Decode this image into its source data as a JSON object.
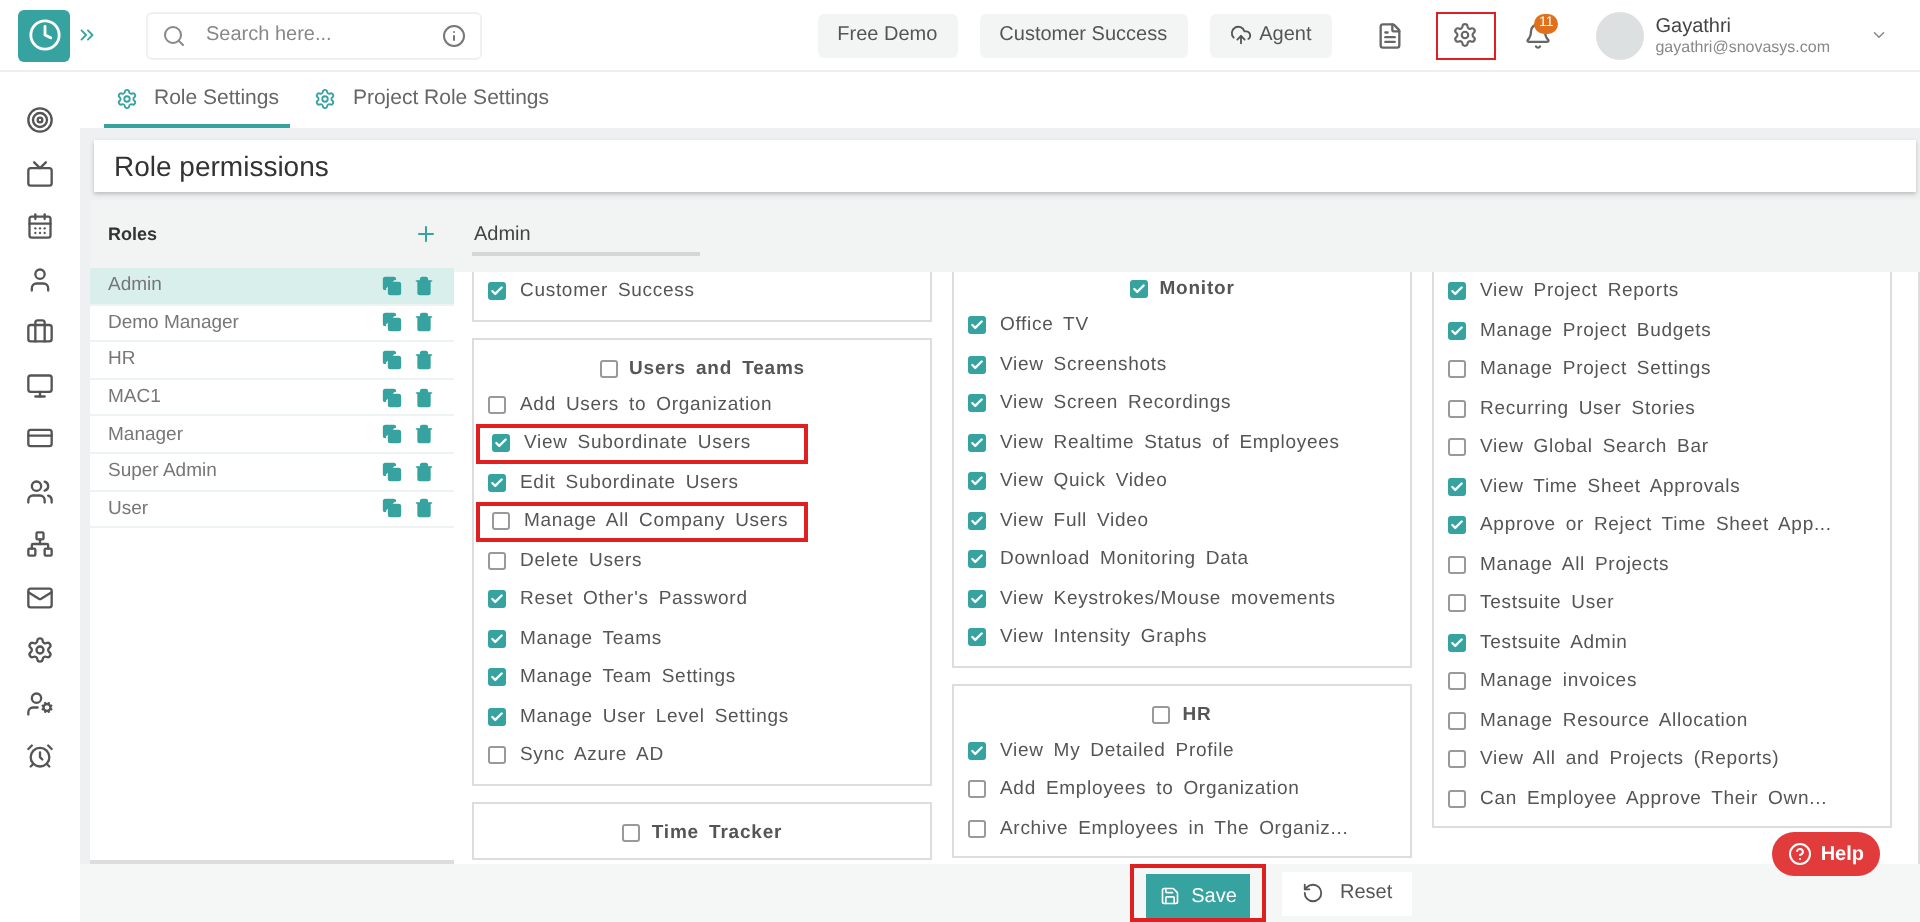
{
  "top_bar": {
    "search": {
      "placeholder": "Search here..."
    },
    "buttons": [
      {
        "label": "Free Demo",
        "kind": "plain"
      },
      {
        "label": "Customer Success",
        "kind": "plain"
      },
      {
        "label": "Agent",
        "kind": "cloud"
      }
    ],
    "settings_highlighted": true,
    "notification_count": "11",
    "user": {
      "name": "Gayathri",
      "email": "gayathri@snovasys.com"
    }
  },
  "tabs": [
    {
      "label": "Role Settings",
      "selected": true
    },
    {
      "label": "Project Role Settings",
      "selected": false
    }
  ],
  "page_title": "Role permissions",
  "roles": {
    "title": "Roles",
    "items": [
      {
        "name": "Admin",
        "selected": true
      },
      {
        "name": "Demo Manager",
        "selected": false
      },
      {
        "name": "HR",
        "selected": false
      },
      {
        "name": "MAC1",
        "selected": false
      },
      {
        "name": "Manager",
        "selected": false
      },
      {
        "name": "Super Admin",
        "selected": false
      },
      {
        "name": "User",
        "selected": false
      }
    ]
  },
  "permissions": {
    "role_value": "Admin",
    "columns": [
      {
        "groups": [
          {
            "items": [
              {
                "label": "Customer Success",
                "checked": true,
                "highlighted": false
              }
            ]
          },
          {
            "title": "Users and Teams",
            "checked": false,
            "items": [
              {
                "label": "Add Users to Organization",
                "checked": false,
                "highlighted": false
              },
              {
                "label": "View Subordinate Users",
                "checked": true,
                "highlighted": true
              },
              {
                "label": "Edit Subordinate Users",
                "checked": true,
                "highlighted": false
              },
              {
                "label": "Manage All Company Users",
                "checked": false,
                "highlighted": true
              },
              {
                "label": "Delete Users",
                "checked": false,
                "highlighted": false
              },
              {
                "label": "Reset Other's Password",
                "checked": true,
                "highlighted": false
              },
              {
                "label": "Manage Teams",
                "checked": true,
                "highlighted": false
              },
              {
                "label": "Manage Team Settings",
                "checked": true,
                "highlighted": false
              },
              {
                "label": "Manage User Level Settings",
                "checked": true,
                "highlighted": false
              },
              {
                "label": "Sync Azure AD",
                "checked": false,
                "highlighted": false
              }
            ]
          },
          {
            "title": "Time Tracker",
            "checked": false
          }
        ]
      },
      {
        "groups": [
          {
            "title": "Monitor",
            "checked": true,
            "items": [
              {
                "label": "Office TV",
                "checked": true,
                "highlighted": false
              },
              {
                "label": "View Screenshots",
                "checked": true,
                "highlighted": false
              },
              {
                "label": "View Screen Recordings",
                "checked": true,
                "highlighted": false
              },
              {
                "label": "View Realtime Status of Employees",
                "checked": true,
                "highlighted": false
              },
              {
                "label": "View Quick Video",
                "checked": true,
                "highlighted": false
              },
              {
                "label": "View Full Video",
                "checked": true,
                "highlighted": false
              },
              {
                "label": "Download Monitoring Data",
                "checked": true,
                "highlighted": false
              },
              {
                "label": "View Keystrokes/Mouse movements",
                "checked": true,
                "highlighted": false
              },
              {
                "label": "View Intensity Graphs",
                "checked": true,
                "highlighted": false
              }
            ]
          },
          {
            "title": "HR",
            "checked": false,
            "items": [
              {
                "label": "View My Detailed Profile",
                "checked": true,
                "highlighted": false
              },
              {
                "label": "Add Employees to Organization",
                "checked": false,
                "highlighted": false
              },
              {
                "label": "Archive Employees in The Organiz...",
                "checked": false,
                "highlighted": false
              }
            ]
          }
        ]
      },
      {
        "groups": [
          {
            "items": [
              {
                "label": "View Project Reports",
                "checked": true,
                "highlighted": false
              },
              {
                "label": "Manage Project Budgets",
                "checked": true,
                "highlighted": false
              },
              {
                "label": "Manage Project Settings",
                "checked": false,
                "highlighted": false
              },
              {
                "label": "Recurring User Stories",
                "checked": false,
                "highlighted": false
              },
              {
                "label": "View Global Search Bar",
                "checked": false,
                "highlighted": false
              },
              {
                "label": "View Time Sheet Approvals",
                "checked": true,
                "highlighted": false
              },
              {
                "label": "Approve or Reject Time Sheet App...",
                "checked": true,
                "highlighted": false
              },
              {
                "label": "Manage All Projects",
                "checked": false,
                "highlighted": false
              },
              {
                "label": "Testsuite User",
                "checked": false,
                "highlighted": false
              },
              {
                "label": "Testsuite Admin",
                "checked": true,
                "highlighted": false
              },
              {
                "label": "Manage invoices",
                "checked": false,
                "highlighted": false
              },
              {
                "label": "Manage Resource Allocation",
                "checked": false,
                "highlighted": false
              },
              {
                "label": "View All and Projects (Reports)",
                "checked": false,
                "highlighted": false
              },
              {
                "label": "Can Employee Approve Their Own...",
                "checked": false,
                "highlighted": false
              }
            ]
          }
        ]
      }
    ]
  },
  "footer": {
    "save": {
      "label": "Save",
      "highlighted": true
    },
    "reset": {
      "label": "Reset"
    },
    "help": {
      "label": "Help"
    }
  }
}
